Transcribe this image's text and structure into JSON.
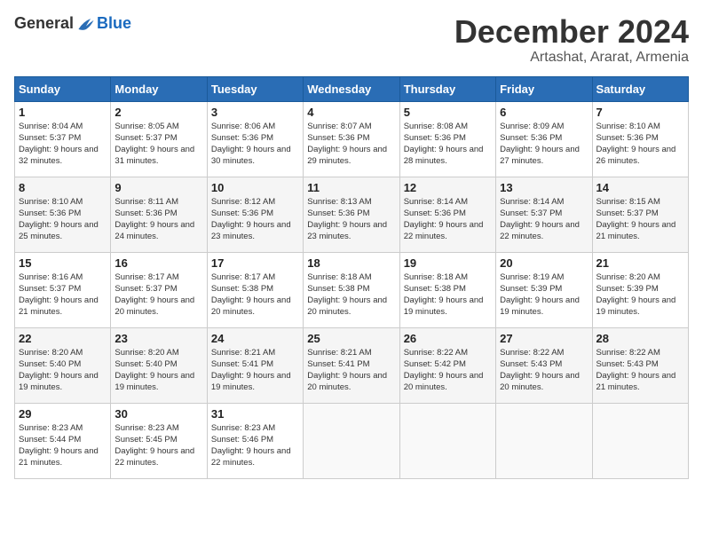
{
  "header": {
    "logo_general": "General",
    "logo_blue": "Blue",
    "month_title": "December 2024",
    "subtitle": "Artashat, Ararat, Armenia"
  },
  "calendar": {
    "days_of_week": [
      "Sunday",
      "Monday",
      "Tuesday",
      "Wednesday",
      "Thursday",
      "Friday",
      "Saturday"
    ],
    "weeks": [
      [
        {
          "day": "1",
          "sunrise": "8:04 AM",
          "sunset": "5:37 PM",
          "daylight": "9 hours and 32 minutes."
        },
        {
          "day": "2",
          "sunrise": "8:05 AM",
          "sunset": "5:37 PM",
          "daylight": "9 hours and 31 minutes."
        },
        {
          "day": "3",
          "sunrise": "8:06 AM",
          "sunset": "5:36 PM",
          "daylight": "9 hours and 30 minutes."
        },
        {
          "day": "4",
          "sunrise": "8:07 AM",
          "sunset": "5:36 PM",
          "daylight": "9 hours and 29 minutes."
        },
        {
          "day": "5",
          "sunrise": "8:08 AM",
          "sunset": "5:36 PM",
          "daylight": "9 hours and 28 minutes."
        },
        {
          "day": "6",
          "sunrise": "8:09 AM",
          "sunset": "5:36 PM",
          "daylight": "9 hours and 27 minutes."
        },
        {
          "day": "7",
          "sunrise": "8:10 AM",
          "sunset": "5:36 PM",
          "daylight": "9 hours and 26 minutes."
        }
      ],
      [
        {
          "day": "8",
          "sunrise": "8:10 AM",
          "sunset": "5:36 PM",
          "daylight": "9 hours and 25 minutes."
        },
        {
          "day": "9",
          "sunrise": "8:11 AM",
          "sunset": "5:36 PM",
          "daylight": "9 hours and 24 minutes."
        },
        {
          "day": "10",
          "sunrise": "8:12 AM",
          "sunset": "5:36 PM",
          "daylight": "9 hours and 23 minutes."
        },
        {
          "day": "11",
          "sunrise": "8:13 AM",
          "sunset": "5:36 PM",
          "daylight": "9 hours and 23 minutes."
        },
        {
          "day": "12",
          "sunrise": "8:14 AM",
          "sunset": "5:36 PM",
          "daylight": "9 hours and 22 minutes."
        },
        {
          "day": "13",
          "sunrise": "8:14 AM",
          "sunset": "5:37 PM",
          "daylight": "9 hours and 22 minutes."
        },
        {
          "day": "14",
          "sunrise": "8:15 AM",
          "sunset": "5:37 PM",
          "daylight": "9 hours and 21 minutes."
        }
      ],
      [
        {
          "day": "15",
          "sunrise": "8:16 AM",
          "sunset": "5:37 PM",
          "daylight": "9 hours and 21 minutes."
        },
        {
          "day": "16",
          "sunrise": "8:17 AM",
          "sunset": "5:37 PM",
          "daylight": "9 hours and 20 minutes."
        },
        {
          "day": "17",
          "sunrise": "8:17 AM",
          "sunset": "5:38 PM",
          "daylight": "9 hours and 20 minutes."
        },
        {
          "day": "18",
          "sunrise": "8:18 AM",
          "sunset": "5:38 PM",
          "daylight": "9 hours and 20 minutes."
        },
        {
          "day": "19",
          "sunrise": "8:18 AM",
          "sunset": "5:38 PM",
          "daylight": "9 hours and 19 minutes."
        },
        {
          "day": "20",
          "sunrise": "8:19 AM",
          "sunset": "5:39 PM",
          "daylight": "9 hours and 19 minutes."
        },
        {
          "day": "21",
          "sunrise": "8:20 AM",
          "sunset": "5:39 PM",
          "daylight": "9 hours and 19 minutes."
        }
      ],
      [
        {
          "day": "22",
          "sunrise": "8:20 AM",
          "sunset": "5:40 PM",
          "daylight": "9 hours and 19 minutes."
        },
        {
          "day": "23",
          "sunrise": "8:20 AM",
          "sunset": "5:40 PM",
          "daylight": "9 hours and 19 minutes."
        },
        {
          "day": "24",
          "sunrise": "8:21 AM",
          "sunset": "5:41 PM",
          "daylight": "9 hours and 19 minutes."
        },
        {
          "day": "25",
          "sunrise": "8:21 AM",
          "sunset": "5:41 PM",
          "daylight": "9 hours and 20 minutes."
        },
        {
          "day": "26",
          "sunrise": "8:22 AM",
          "sunset": "5:42 PM",
          "daylight": "9 hours and 20 minutes."
        },
        {
          "day": "27",
          "sunrise": "8:22 AM",
          "sunset": "5:43 PM",
          "daylight": "9 hours and 20 minutes."
        },
        {
          "day": "28",
          "sunrise": "8:22 AM",
          "sunset": "5:43 PM",
          "daylight": "9 hours and 21 minutes."
        }
      ],
      [
        {
          "day": "29",
          "sunrise": "8:23 AM",
          "sunset": "5:44 PM",
          "daylight": "9 hours and 21 minutes."
        },
        {
          "day": "30",
          "sunrise": "8:23 AM",
          "sunset": "5:45 PM",
          "daylight": "9 hours and 22 minutes."
        },
        {
          "day": "31",
          "sunrise": "8:23 AM",
          "sunset": "5:46 PM",
          "daylight": "9 hours and 22 minutes."
        },
        null,
        null,
        null,
        null
      ]
    ]
  }
}
